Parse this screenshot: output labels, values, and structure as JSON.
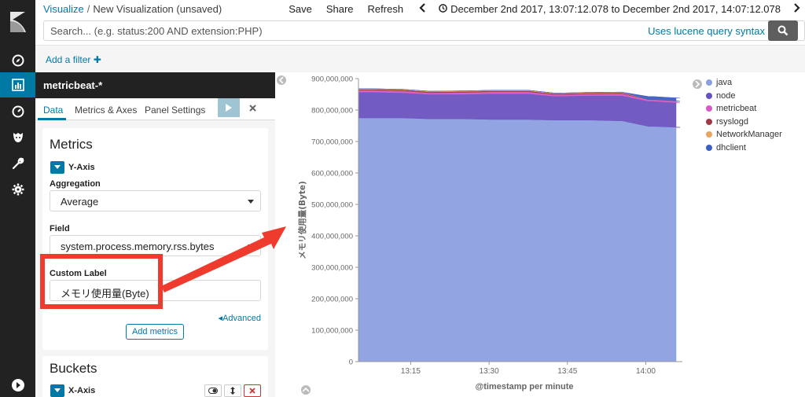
{
  "breadcrumb": {
    "parent": "Visualize",
    "separator": "/",
    "current": "New Visualization (unsaved)"
  },
  "top_actions": {
    "save": "Save",
    "share": "Share",
    "refresh": "Refresh",
    "time_range": "December 2nd 2017, 13:07:12.078 to December 2nd 2017, 14:07:12.078"
  },
  "query": {
    "placeholder": "Search... (e.g. status:200 AND extension:PHP)",
    "syntax_link": "Uses lucene query syntax"
  },
  "filter": {
    "add_label": "Add a filter"
  },
  "sidebar": {
    "index_pattern": "metricbeat-*",
    "tabs": [
      "Data",
      "Metrics & Axes",
      "Panel Settings"
    ],
    "metrics": {
      "title": "Metrics",
      "agg_title": "Y-Axis",
      "aggregation_label": "Aggregation",
      "aggregation_value": "Average",
      "field_label": "Field",
      "field_value": "system.process.memory.rss.bytes",
      "custom_label_label": "Custom Label",
      "custom_label_value": "メモリ使用量(Byte)",
      "advanced": "Advanced",
      "add_metrics": "Add metrics"
    },
    "buckets": {
      "title": "Buckets",
      "agg_title": "X-Axis"
    }
  },
  "colors": {
    "rail": "#222222",
    "accent": "#0079a5",
    "highlight": "#ef3b2d"
  },
  "chart_data": {
    "type": "area",
    "stacked": true,
    "xlabel": "@timestamp per minute",
    "ylabel": "メモリ使用量(Byte)",
    "ylim": [
      0,
      900000000
    ],
    "yticks": [
      0,
      100000000,
      200000000,
      300000000,
      400000000,
      500000000,
      600000000,
      700000000,
      800000000,
      900000000
    ],
    "ytick_labels": [
      "0",
      "100,000,000",
      "200,000,000",
      "300,000,000",
      "400,000,000",
      "500,000,000",
      "600,000,000",
      "700,000,000",
      "800,000,000",
      "900,000,000"
    ],
    "xtick_labels": [
      "13:15",
      "13:30",
      "13:45",
      "14:00"
    ],
    "xtick_minutes": [
      15,
      30,
      45,
      60
    ],
    "x_minutes": [
      7,
      13,
      19,
      25,
      31,
      37,
      43,
      49,
      55,
      61,
      67
    ],
    "legend_position": "right",
    "series": [
      {
        "name": "java",
        "color": "#8c9fdf",
        "values": [
          775000000,
          775000000,
          772000000,
          772000000,
          770000000,
          770000000,
          768000000,
          768000000,
          766000000,
          748000000,
          745000000
        ]
      },
      {
        "name": "node",
        "color": "#6a52be",
        "values": [
          82000000,
          80000000,
          78000000,
          78000000,
          82000000,
          82000000,
          76000000,
          78000000,
          80000000,
          80000000,
          78000000
        ]
      },
      {
        "name": "metricbeat",
        "color": "#d55bc5",
        "values": [
          6000000,
          6000000,
          5000000,
          6000000,
          6000000,
          6000000,
          5000000,
          5000000,
          6000000,
          5000000,
          5000000
        ]
      },
      {
        "name": "rsyslogd",
        "color": "#9e3a47",
        "values": [
          3000000,
          3000000,
          3000000,
          3000000,
          3000000,
          3000000,
          3000000,
          3000000,
          3000000,
          0,
          0
        ]
      },
      {
        "name": "NetworkManager",
        "color": "#e7a664",
        "values": [
          2000000,
          2000000,
          2000000,
          2000000,
          2000000,
          2000000,
          2000000,
          2000000,
          2000000,
          0,
          0
        ]
      },
      {
        "name": "dhclient",
        "color": "#3d5fbf",
        "values": [
          0,
          0,
          0,
          0,
          0,
          0,
          0,
          0,
          0,
          10000000,
          10000000
        ]
      }
    ]
  }
}
